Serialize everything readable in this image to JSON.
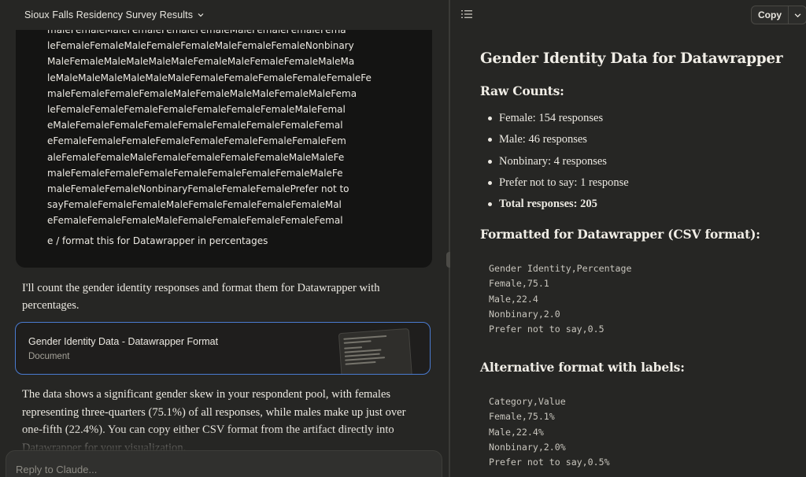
{
  "chat": {
    "title": "Sioux Falls Residency Survey Results",
    "user_message_lines": [
      "maleFemaleMaleFemaleFemaleFemaleMaleFemaleFemaleFema",
      "leFemaleFemaleMaleFemaleFemaleMaleFemaleFemaleNonbinary",
      "MaleFemaleMaleMaleMaleMaleFemaleMaleFemaleFemaleMaleMa",
      "leMaleMaleMaleMaleMaleMaleFemaleFemaleFemaleFemaleFemaleFe",
      "maleFemaleFemaleFemaleMaleFemaleMaleMaleFemaleMaleFema",
      "leFemaleFemaleFemaleFemaleFemaleFemaleFemaleMaleFemal",
      "eMaleFemaleFemaleFemaleFemaleFemaleFemaleFemaleFemal",
      "eFemaleFemaleFemaleFemaleFemaleFemaleFemaleFemaleFem",
      "aleFemaleFemaleMaleFemaleFemaleFemaleFemaleMaleMaleFe",
      "maleFemaleFemaleFemaleFemaleFemaleFemaleFemaleMaleFe",
      "maleFemaleFemaleNonbinaryFemaleFemaleFemalePrefer not to",
      "sayFemaleFemaleFemaleMaleFemaleFemaleFemaleFemaleMal",
      "eFemaleFemaleFemaleMaleFemaleFemaleFemaleFemaleFemal"
    ],
    "user_message_tail": "e / format this for Datawrapper in percentages",
    "assistant_intro": "I'll count the gender identity responses and format them for Datawrapper with percentages.",
    "artifact": {
      "title": "Gender Identity Data - Datawrapper Format",
      "type": "Document"
    },
    "assistant_summary": "The data shows a significant gender skew in your respondent pool, with females representing three-quarters (75.1%) of all responses, while males make up just over one-fifth (22.4%). You can copy either CSV format from the artifact directly into Datawrapper for your visualization.",
    "composer_placeholder": "Reply to Claude..."
  },
  "artifact_panel": {
    "copy_label": "Copy",
    "doc_title": "Gender Identity Data for Datawrapper",
    "raw_heading": "Raw Counts:",
    "raw_items": [
      "Female: 154 responses",
      "Male: 46 responses",
      "Nonbinary: 4 responses",
      "Prefer not to say: 1 response",
      "Total responses: 205"
    ],
    "csv_heading": "Formatted for Datawrapper (CSV format):",
    "csv_lines": [
      "Gender Identity,Percentage",
      "Female,75.1",
      "Male,22.4",
      "Nonbinary,2.0",
      "Prefer not to say,0.5"
    ],
    "alt_heading": "Alternative format with labels:",
    "alt_lines": [
      "Category,Value",
      "Female,75.1%",
      "Male,22.4%",
      "Nonbinary,2.0%",
      "Prefer not to say,0.5%"
    ]
  },
  "icons": {
    "chevron": "chevron-down-icon",
    "list": "list-icon"
  },
  "colors": {
    "background": "#262624",
    "user_bubble": "#141413",
    "artifact_border": "#4a7bd1",
    "text": "#ece9e2"
  }
}
